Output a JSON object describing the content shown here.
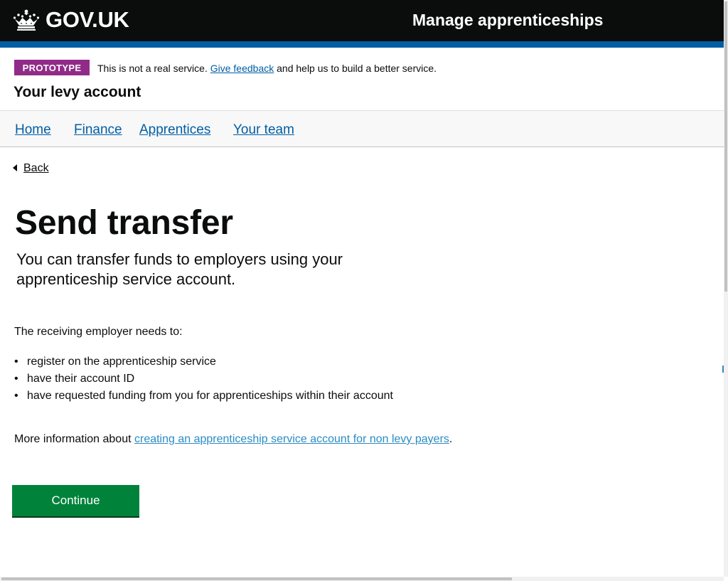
{
  "header": {
    "logo_text": "GOV.UK",
    "service_name": "Manage apprenticeships",
    "background_color": "#0b0c0c",
    "stripe_color": "#005ea5"
  },
  "phase_banner": {
    "tag": "PROTOTYPE",
    "text_before": "This is not a real service.",
    "feedback_link": "Give feedback",
    "text_after": "and help us to build a better service.",
    "tag_color": "#912b88"
  },
  "account_title": "Your levy account",
  "nav": {
    "items": [
      {
        "label": "Home"
      },
      {
        "label": "Finance"
      },
      {
        "label": "Apprentices"
      },
      {
        "label": "Your team"
      }
    ]
  },
  "back_link": "Back",
  "main": {
    "heading": "Send transfer",
    "lede": "You can transfer funds to employers using your apprenticeship service account.",
    "intro": "The receiving employer needs to:",
    "bullets": [
      "register on the apprenticeship service",
      "have their account ID",
      "have requested funding from you for apprenticeships within their account"
    ],
    "more_info_prefix": "More information about",
    "more_info_link": "creating an apprenticeship service account for non levy payers",
    "more_info_suffix": ".",
    "continue_label": "Continue",
    "button_color": "#00823b",
    "link_color": "#2b8cc4"
  }
}
